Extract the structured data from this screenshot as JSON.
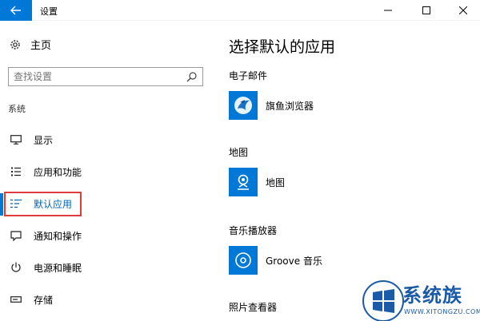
{
  "window": {
    "title": "设置"
  },
  "sidebar": {
    "home_label": "主页",
    "search_placeholder": "查找设置",
    "section_label": "系统",
    "items": [
      {
        "label": "显示",
        "icon": "monitor-icon"
      },
      {
        "label": "应用和功能",
        "icon": "list-icon"
      },
      {
        "label": "默认应用",
        "icon": "default-apps-icon",
        "selected": true
      },
      {
        "label": "通知和操作",
        "icon": "notification-icon"
      },
      {
        "label": "电源和睡眠",
        "icon": "power-icon"
      },
      {
        "label": "存储",
        "icon": "storage-icon"
      }
    ]
  },
  "main": {
    "title": "选择默认的应用",
    "categories": [
      {
        "label": "电子邮件",
        "app": "旗鱼浏览器",
        "icon": "swordfish-browser-icon"
      },
      {
        "label": "地图",
        "app": "地图",
        "icon": "maps-icon"
      },
      {
        "label": "音乐播放器",
        "app": "Groove 音乐",
        "icon": "groove-music-icon"
      },
      {
        "label": "照片查看器",
        "app": "",
        "icon": ""
      }
    ]
  },
  "watermark": {
    "text": "系统族",
    "sub": "WWW.XITONGZU.COM"
  },
  "colors": {
    "accent": "#0078d7",
    "highlight_box": "#e03c3c",
    "watermark": "#1a5aa8"
  }
}
